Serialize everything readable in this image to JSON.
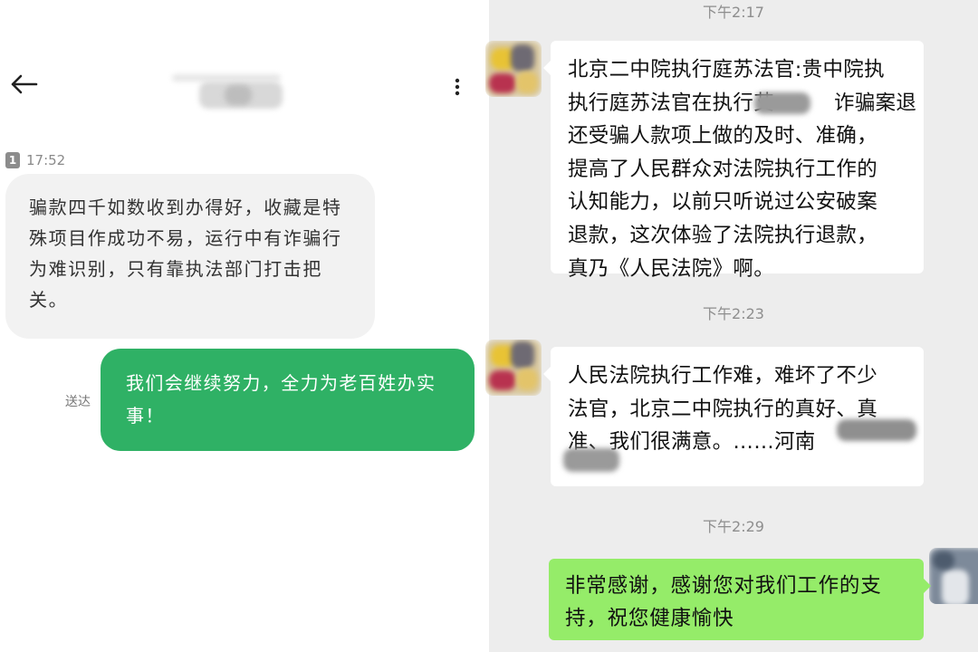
{
  "left_panel": {
    "header": {
      "back_icon": "back-arrow-icon",
      "more_icon": "more-vertical-icon"
    },
    "sim_badge": "1",
    "time": "17:52",
    "incoming_message": {
      "lines": [
        "骗款四千如数收到办得好，收藏是特",
        "殊项目作成功不易，运行中有诈骗行",
        "为难识别，只有靠执法部门打击把",
        "关。"
      ]
    },
    "sent_label": "送达",
    "outgoing_message": {
      "lines": [
        "我们会继续努力，全力为老百姓办实",
        "事！"
      ]
    },
    "colors": {
      "outgoing_bubble": "#2fb165",
      "incoming_bubble": "#f2f2f2"
    }
  },
  "right_panel": {
    "timestamps": [
      "下午2:17",
      "下午2:23",
      "下午2:29"
    ],
    "message1": {
      "lines": [
        "北京二中院执行庭苏法官:贵中院执",
        "执行庭苏法官在执行艾",
        "诈骗案退",
        "还受骗人款项上做的及时、准确，",
        "提高了人民群众对法院执行工作的",
        "认知能力，以前只听说过公安破案",
        "退款，这次体验了法院执行退款，",
        "真乃《人民法院》啊。"
      ]
    },
    "message2": {
      "lines": [
        "人民法院执行工作难，难坏了不少",
        "法官，北京二中院执行的真好、真",
        "准、我们很满意。……河南"
      ]
    },
    "message3": {
      "lines": [
        "非常感谢，感谢您对我们工作的支",
        "持，祝您健康愉快"
      ]
    },
    "colors": {
      "background": "#ededed",
      "outgoing_bubble": "#95ec69",
      "incoming_bubble": "#ffffff"
    }
  }
}
